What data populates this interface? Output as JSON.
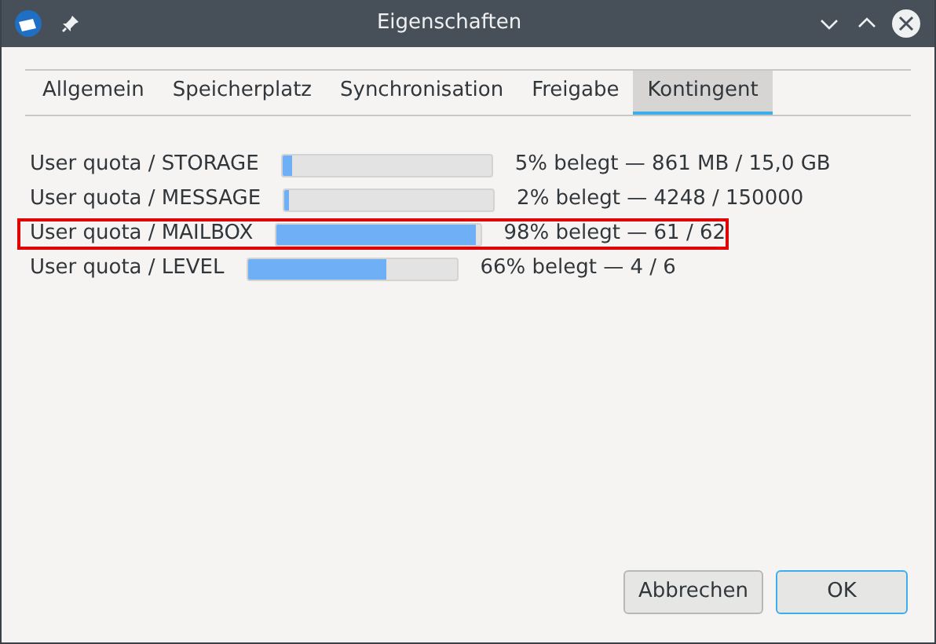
{
  "window": {
    "title": "Eigenschaften"
  },
  "tabs": [
    {
      "label": "Allgemein",
      "selected": false
    },
    {
      "label": "Speicherplatz",
      "selected": false
    },
    {
      "label": "Synchronisation",
      "selected": false
    },
    {
      "label": "Freigabe",
      "selected": false
    },
    {
      "label": "Kontingent",
      "selected": true
    }
  ],
  "quotas": [
    {
      "name": "User quota / STORAGE",
      "level": 0.05,
      "reading": "5% belegt — 861 MB / 15,0 GB",
      "highlighted": false
    },
    {
      "name": "User quota / MESSAGE",
      "level": 0.02,
      "reading": "2% belegt — 4248 / 150000",
      "highlighted": false
    },
    {
      "name": "User quota / MAILBOX",
      "level": 0.98,
      "reading": "98% belegt — 61 / 62",
      "highlighted": true
    },
    {
      "name": "User quota / LEVEL",
      "level": 0.66,
      "reading": "66% belegt — 4 / 6",
      "highlighted": false
    }
  ],
  "buttons": [
    {
      "label": "Abbrechen",
      "default": false
    },
    {
      "label": "OK",
      "default": true
    }
  ]
}
